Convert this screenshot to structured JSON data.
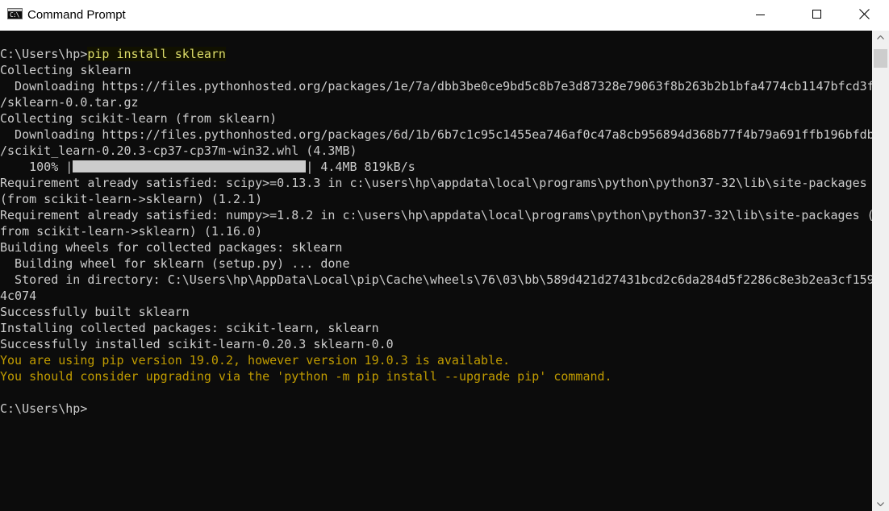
{
  "window": {
    "title": "Command Prompt",
    "icon_glyph": "C:\\",
    "icon": "cmd-icon"
  },
  "colors": {
    "console_bg": "#0c0c0c",
    "console_text": "#cccccc",
    "warning_text": "#c19c00",
    "highlight_text": "#dede6a"
  },
  "console": {
    "line1_prompt": "C:\\Users\\hp>",
    "line1_command": "pip install sklearn",
    "line2": "Collecting sklearn",
    "line3": "  Downloading https://files.pythonhosted.org/packages/1e/7a/dbb3be0ce9bd5c8b7e3d87328e79063f8b263b2b1bfa4774cb1147bfcd3f",
    "line4": "/sklearn-0.0.tar.gz",
    "line5": "Collecting scikit-learn (from sklearn)",
    "line6": "  Downloading https://files.pythonhosted.org/packages/6d/1b/6b7c1c95c1455ea746af0c47a8cb956894d368b77f4b79a691ffb196bfdb",
    "line7": "/scikit_learn-0.20.3-cp37-cp37m-win32.whl (4.3MB)",
    "progress": {
      "percent_label": "    100% ",
      "left_border": "|",
      "right_border": "|",
      "fraction": 1.0,
      "stats": " 4.4MB 819kB/s"
    },
    "line9": "Requirement already satisfied: scipy>=0.13.3 in c:\\users\\hp\\appdata\\local\\programs\\python\\python37-32\\lib\\site-packages",
    "line10": "(from scikit-learn->sklearn) (1.2.1)",
    "line11": "Requirement already satisfied: numpy>=1.8.2 in c:\\users\\hp\\appdata\\local\\programs\\python\\python37-32\\lib\\site-packages (",
    "line12": "from scikit-learn->sklearn) (1.16.0)",
    "line13": "Building wheels for collected packages: sklearn",
    "line14": "  Building wheel for sklearn (setup.py) ... done",
    "line15": "  Stored in directory: C:\\Users\\hp\\AppData\\Local\\pip\\Cache\\wheels\\76\\03\\bb\\589d421d27431bcd2c6da284d5f2286c8e3b2ea3cf159",
    "line16": "4c074",
    "line17": "Successfully built sklearn",
    "line18": "Installing collected packages: scikit-learn, sklearn",
    "line19": "Successfully installed scikit-learn-0.20.3 sklearn-0.0",
    "line20": "You are using pip version 19.0.2, however version 19.0.3 is available.",
    "line21": "You should consider upgrading via the 'python -m pip install --upgrade pip' command.",
    "line22": "",
    "line23": "C:\\Users\\hp>"
  },
  "controls": {
    "minimize_icon": "minimize-icon",
    "maximize_icon": "maximize-icon",
    "close_icon": "close-icon",
    "scroll_up_icon": "chevron-up-icon",
    "scroll_down_icon": "chevron-down-icon"
  }
}
